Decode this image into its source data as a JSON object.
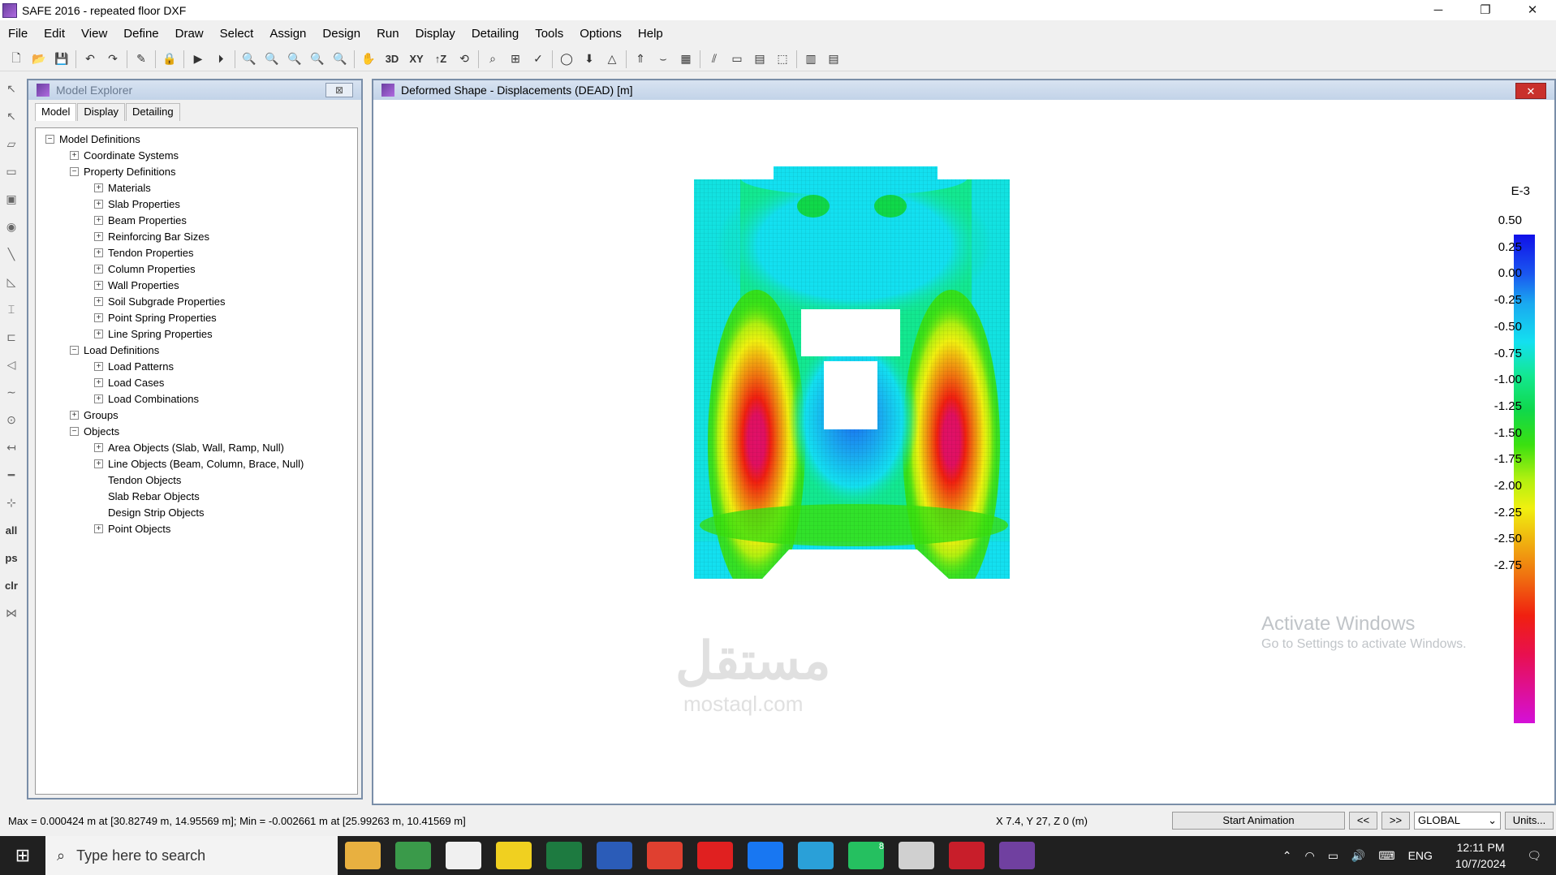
{
  "window": {
    "title": "SAFE 2016 - repeated floor DXF",
    "min": "─",
    "max": "❐",
    "close": "✕"
  },
  "menu": [
    "File",
    "Edit",
    "View",
    "Define",
    "Draw",
    "Select",
    "Assign",
    "Design",
    "Run",
    "Display",
    "Detailing",
    "Tools",
    "Options",
    "Help"
  ],
  "toolbar": {
    "view3d": "3D",
    "viewxy": "XY",
    "viewz": "↑Z"
  },
  "lefttools": {
    "all": "all",
    "ps": "ps",
    "clr": "clr"
  },
  "explorer": {
    "title": "Model Explorer",
    "close": "⊠",
    "tabs": [
      "Model",
      "Display",
      "Detailing"
    ],
    "tree": [
      {
        "label": "Model Definitions",
        "level": 0,
        "toggle": "−"
      },
      {
        "label": "Coordinate Systems",
        "level": 1,
        "toggle": "+"
      },
      {
        "label": "Property Definitions",
        "level": 1,
        "toggle": "−"
      },
      {
        "label": "Materials",
        "level": 2,
        "toggle": "+"
      },
      {
        "label": "Slab Properties",
        "level": 2,
        "toggle": "+"
      },
      {
        "label": "Beam Properties",
        "level": 2,
        "toggle": "+"
      },
      {
        "label": "Reinforcing Bar Sizes",
        "level": 2,
        "toggle": "+"
      },
      {
        "label": "Tendon Properties",
        "level": 2,
        "toggle": "+"
      },
      {
        "label": "Column Properties",
        "level": 2,
        "toggle": "+"
      },
      {
        "label": "Wall Properties",
        "level": 2,
        "toggle": "+"
      },
      {
        "label": "Soil Subgrade Properties",
        "level": 2,
        "toggle": "+"
      },
      {
        "label": "Point Spring Properties",
        "level": 2,
        "toggle": "+"
      },
      {
        "label": "Line Spring Properties",
        "level": 2,
        "toggle": "+"
      },
      {
        "label": "Load Definitions",
        "level": 1,
        "toggle": "−"
      },
      {
        "label": "Load Patterns",
        "level": 2,
        "toggle": "+"
      },
      {
        "label": "Load Cases",
        "level": 2,
        "toggle": "+"
      },
      {
        "label": "Load Combinations",
        "level": 2,
        "toggle": "+"
      },
      {
        "label": "Groups",
        "level": 1,
        "toggle": "+"
      },
      {
        "label": "Objects",
        "level": 1,
        "toggle": "−"
      },
      {
        "label": "Area Objects (Slab, Wall, Ramp, Null)",
        "level": 2,
        "toggle": "+"
      },
      {
        "label": "Line Objects (Beam, Column, Brace, Null)",
        "level": 2,
        "toggle": "+"
      },
      {
        "label": "Tendon Objects",
        "level": 2,
        "toggle": ""
      },
      {
        "label": "Slab Rebar Objects",
        "level": 2,
        "toggle": ""
      },
      {
        "label": "Design Strip Objects",
        "level": 2,
        "toggle": ""
      },
      {
        "label": "Point Objects",
        "level": 2,
        "toggle": "+"
      }
    ]
  },
  "view": {
    "title": "Deformed Shape - Displacements (DEAD)  [m]",
    "close": "✕",
    "legend": {
      "unit": "E-3",
      "values": [
        "0.50",
        "0.25",
        "0.00",
        "-0.25",
        "-0.50",
        "-0.75",
        "-1.00",
        "-1.25",
        "-1.50",
        "-1.75",
        "-2.00",
        "-2.25",
        "-2.50",
        "-2.75"
      ]
    },
    "activate": {
      "line1": "Activate Windows",
      "line2": "Go to Settings to activate Windows."
    },
    "watermark": "مستقل",
    "watermark2": "mostaql.com"
  },
  "status": {
    "maxmin": "Max = 0.000424 m at [30.82749 m, 14.95569 m];  Min = -0.002661 m at [25.99263 m, 10.41569 m]",
    "coords": "X 7.4,  Y 27,  Z 0  (m)",
    "animation": "Start Animation",
    "prev": "<<",
    "next": ">>",
    "coord_system": "GLOBAL",
    "units": "Units..."
  },
  "taskbar": {
    "search_placeholder": "Type here to search",
    "lang": "ENG",
    "time": "12:11 PM",
    "date": "10/7/2024",
    "badge": "8"
  }
}
